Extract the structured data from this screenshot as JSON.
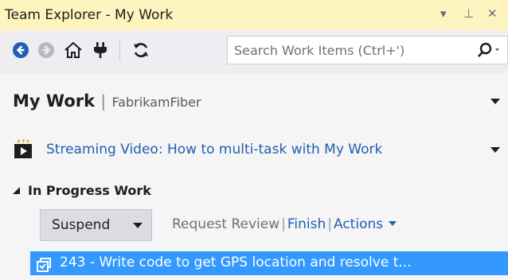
{
  "window": {
    "title": "Team Explorer - My Work",
    "dropdown_glyph": "▾",
    "pin_glyph": "⊥",
    "close_glyph": "✕"
  },
  "toolbar": {
    "icons": [
      "back-icon",
      "forward-icon",
      "home-icon",
      "connect-icon",
      "refresh-icon"
    ],
    "search_placeholder": "Search Work Items (Ctrl+')"
  },
  "page": {
    "title": "My Work",
    "separator": "|",
    "project": "FabrikamFiber"
  },
  "video": {
    "label": "Streaming Video: How to multi-task with My Work"
  },
  "in_progress": {
    "header": "In Progress Work",
    "suspend_label": "Suspend",
    "links": {
      "request_review": "Request Review",
      "finish": "Finish",
      "actions": "Actions"
    },
    "work_item": "243 - Write code to get GPS location and resolve t..."
  },
  "colors": {
    "titlebar": "#fdf4bf",
    "toolbar": "#eeeef2",
    "accent": "#1e5fb3",
    "selection": "#3399ff"
  }
}
